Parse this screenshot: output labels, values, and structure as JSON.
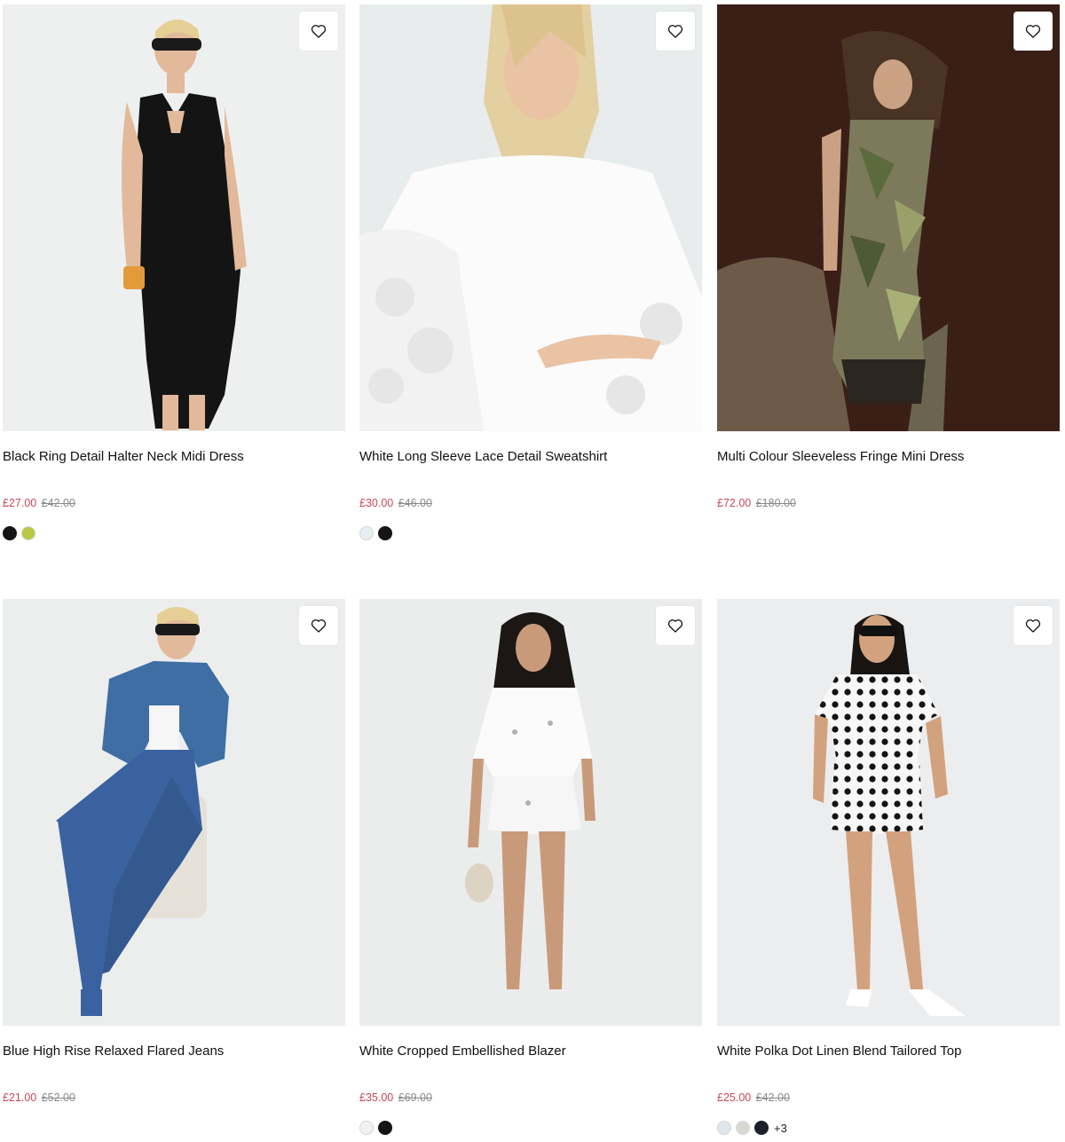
{
  "colors": {
    "sale_price": "#c8485a",
    "was_price": "#8a8a8a",
    "card_bg": "#eceeee"
  },
  "wishlist_icon": "heart-outline-icon",
  "products": [
    {
      "title": "Black Ring Detail Halter Neck Midi Dress",
      "price_now": "£27.00",
      "price_was": "£42.00",
      "swatches": [
        "#151515",
        "#b8c842"
      ],
      "more": ""
    },
    {
      "title": "White Long Sleeve Lace Detail Sweatshirt",
      "price_now": "£30.00",
      "price_was": "£46.00",
      "swatches": [
        "#e6eef0",
        "#151515"
      ],
      "more": ""
    },
    {
      "title": "Multi Colour Sleeveless Fringe Mini Dress",
      "price_now": "£72.00",
      "price_was": "£180.00",
      "swatches": [],
      "more": ""
    },
    {
      "title": "Blue High Rise Relaxed Flared Jeans",
      "price_now": "£21.00",
      "price_was": "£52.00",
      "swatches": [],
      "more": ""
    },
    {
      "title": "White Cropped Embellished Blazer",
      "price_now": "£35.00",
      "price_was": "£69.00",
      "swatches": [
        "#f1f1f1",
        "#151515"
      ],
      "more": ""
    },
    {
      "title": "White Polka Dot Linen Blend Tailored Top",
      "price_now": "£25.00",
      "price_was": "£42.00",
      "swatches": [
        "#dfe7ee",
        "#d9d9d4",
        "#1c1f2a"
      ],
      "more": "+3"
    }
  ]
}
